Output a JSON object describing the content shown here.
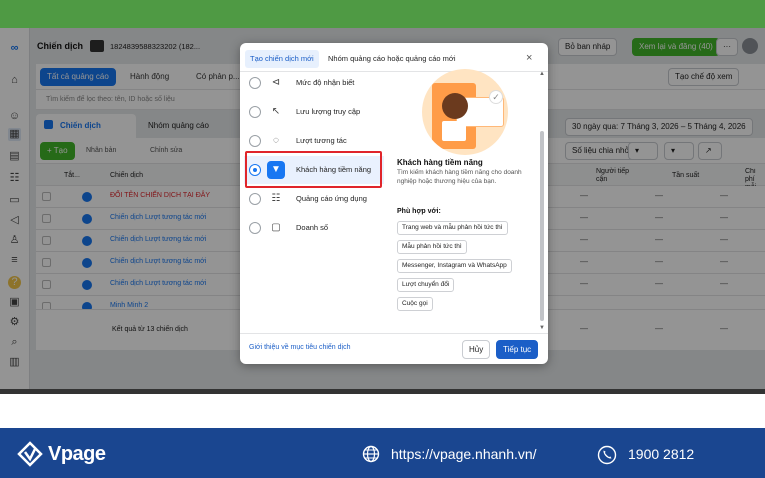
{
  "header": {
    "page_title": "Chiến dịch",
    "account_id": "1824839588323202 (182...",
    "save_draft": "Bỏ ban nháp",
    "review_publish": "Xem lại và đăng (40)",
    "more": "···"
  },
  "toolbar": {
    "all_ads": "Tất cả quảng cáo",
    "action": "Hành động",
    "have": "Có phản p...",
    "search_placeholder": "Tìm kiếm để lọc theo: tên, ID hoặc số liệu",
    "create_view": "Tạo chế độ xem",
    "tab_campaigns": "Chiến dịch",
    "tab_adsets": "Nhóm quảng cáo",
    "date_range": "30 ngày qua: 7 Tháng 3, 2026 – 5 Tháng 4, 2026",
    "create": "+ Tạo",
    "duplicate": "Nhân bản",
    "edit": "Chỉnh sửa",
    "breakdown": "Số liệu chia nhỏ"
  },
  "table": {
    "col_toggle": "Tắt...",
    "col_campaign": "Chiến dịch",
    "col_reach": "Người tiếp cận",
    "col_freq": "Tần suất",
    "col_cost": "Chi phí mỗi",
    "rows": [
      "ĐỔI TÊN CHIẾN DỊCH TẠI ĐÂY",
      "Chiến dịch Lượt tương tác mới",
      "Chiến dịch Lượt tương tác mới",
      "Chiến dịch Lượt tương tác mới",
      "Chiến dịch Lượt tương tác mới",
      "Minh Minh 2"
    ],
    "dash": "—",
    "results_note": "Kết quả từ 13 chiến dịch"
  },
  "modal": {
    "tab_new": "Tạo chiến dịch mới",
    "tab_existing": "Nhóm quảng cáo hoặc quảng cáo mới",
    "close": "×",
    "objectives": [
      {
        "label": "Mức độ nhận biết",
        "icon": "megaphone-icon"
      },
      {
        "label": "Lưu lượng truy cập",
        "icon": "cursor-icon"
      },
      {
        "label": "Lượt tương tác",
        "icon": "chat-icon"
      },
      {
        "label": "Khách hàng tiềm năng",
        "icon": "funnel-icon"
      },
      {
        "label": "Quảng cáo ứng dụng",
        "icon": "people-icon"
      },
      {
        "label": "Doanh số",
        "icon": "shopping-bag-icon"
      }
    ],
    "selected_index": 3,
    "detail_title": "Khách hàng tiềm năng",
    "detail_desc": "Tìm kiếm khách hàng tiềm năng cho doanh nghiệp hoặc thương hiệu của bạn.",
    "fit_label": "Phù hợp với:",
    "fit_tags": [
      "Trang web và mẫu phản hồi tức thì",
      "Mẫu phản hồi tức thì",
      "Messenger, Instagram và WhatsApp",
      "Lượt chuyển đổi",
      "Cuộc gọi"
    ],
    "learn_link": "Giới thiệu về mục tiêu chiến dịch",
    "cancel": "Hủy",
    "continue": "Tiếp tục"
  },
  "footer": {
    "brand": "Vpage",
    "website": "https://vpage.nhanh.vn/",
    "phone": "1900 2812"
  },
  "colors": {
    "brand_blue": "#1877f2",
    "footer_navy": "#1a4690",
    "highlight_red": "#e0252b",
    "topbar_green": "#4f9a44"
  }
}
